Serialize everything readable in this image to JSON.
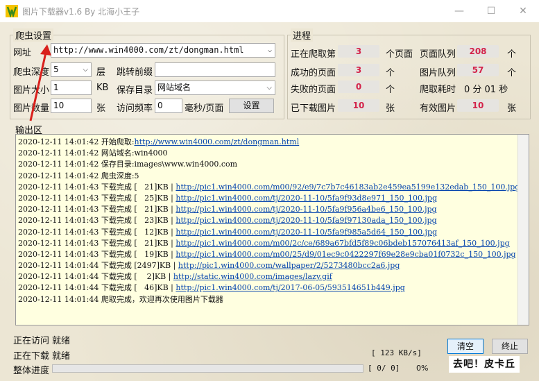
{
  "window": {
    "title": "图片下载器v1.6 By 北海小王子",
    "min_icon": "minimize-icon",
    "max_icon": "maximize-icon",
    "close_icon": "close-icon"
  },
  "settings": {
    "group_title": "爬虫设置",
    "url_label": "网址",
    "url_value": "http://www.win4000.com/zt/dongman.html",
    "depth_label": "爬虫深度",
    "depth_value": "5",
    "depth_unit": "层",
    "jump_prefix_label": "跳转前缀",
    "jump_prefix_value": "",
    "size_label": "图片大小",
    "size_value": "1",
    "size_unit": "KB",
    "save_dir_label": "保存目录",
    "save_dir_value": "网站域名",
    "count_label": "图片数量",
    "count_value": "10",
    "count_unit": "张",
    "freq_label": "访问频率",
    "freq_value": "0",
    "freq_unit": "毫秒/页面",
    "set_button": "设置"
  },
  "progress_group": {
    "title": "进程",
    "crawling_label": "正在爬取第",
    "crawling_value": "3",
    "crawling_unit": "个页面",
    "page_queue_label": "页面队列",
    "page_queue_value": "208",
    "page_queue_unit": "个",
    "success_label": "成功的页面",
    "success_value": "3",
    "success_unit": "个",
    "img_queue_label": "图片队列",
    "img_queue_value": "57",
    "img_queue_unit": "个",
    "fail_label": "失败的页面",
    "fail_value": "0",
    "fail_unit": "个",
    "time_label": "爬取耗时",
    "time_value": "0 分 01 秒",
    "downloaded_label": "已下载图片",
    "downloaded_value": "10",
    "downloaded_unit": "张",
    "valid_label": "有效图片",
    "valid_value": "10",
    "valid_unit": "张"
  },
  "output": {
    "title": "输出区",
    "lines": [
      {
        "text": "2020-12-11 14:01:42 开始爬取:",
        "link": "http://www.win4000.com/zt/dongman.html"
      },
      {
        "text": "2020-12-11 14:01:42 网站域名:win4000",
        "link": ""
      },
      {
        "text": "2020-12-11 14:01:42 保存目录:images\\www.win4000.com",
        "link": ""
      },
      {
        "text": "2020-12-11 14:01:42 爬虫深度:5",
        "link": ""
      },
      {
        "text": "2020-12-11 14:01:43 下载完成 [   21]KB | ",
        "link": "http://pic1.win4000.com/m00/92/e9/7c7b7c46183ab2e459ea5199e132edab_150_100.jpg"
      },
      {
        "text": "2020-12-11 14:01:43 下载完成 [   25]KB | ",
        "link": "http://pic1.win4000.com/tj/2020-11-10/5fa9f93d8e971_150_100.jpg"
      },
      {
        "text": "2020-12-11 14:01:43 下载完成 [   21]KB | ",
        "link": "http://pic1.win4000.com/tj/2020-11-10/5fa9f956a4be6_150_100.jpg"
      },
      {
        "text": "2020-12-11 14:01:43 下载完成 [   23]KB | ",
        "link": "http://pic1.win4000.com/tj/2020-11-10/5fa9f97130ada_150_100.jpg"
      },
      {
        "text": "2020-12-11 14:01:43 下载完成 [   12]KB | ",
        "link": "http://pic1.win4000.com/tj/2020-11-10/5fa9f985a5d64_150_100.jpg"
      },
      {
        "text": "2020-12-11 14:01:43 下载完成 [   21]KB | ",
        "link": "http://pic1.win4000.com/m00/2c/ce/689a67bfd5f89c06bdeb157076413af_150_100.jpg"
      },
      {
        "text": "2020-12-11 14:01:43 下载完成 [   19]KB | ",
        "link": "http://pic1.win4000.com/m00/25/d9/01ec9c0422297f69e28e9cba01f0732c_150_100.jpg"
      },
      {
        "text": "2020-12-11 14:01:44 下载完成 [2497]KB | ",
        "link": "http://pic1.win4000.com/wallpaper/2/5273480bcc2a6.jpg"
      },
      {
        "text": "2020-12-11 14:01:44 下载完成 [    2]KB | ",
        "link": "http://static.win4000.com/images/lazy.gif"
      },
      {
        "text": "2020-12-11 14:01:44 下载完成 [   46]KB | ",
        "link": "http://pic1.win4000.com/tj/2017-06-05/593514651b449.jpg"
      },
      {
        "text": "2020-12-11 14:01:44 爬取完成，欢迎再次使用图片下载器",
        "link": ""
      }
    ]
  },
  "status": {
    "visiting_label": "正在访问",
    "visiting_value": "就绪",
    "downloading_label": "正在下载",
    "downloading_value": "就绪",
    "speed": "[ 123 KB/s]",
    "overall_label": "整体进度",
    "overall_count": "[  0/  0]",
    "overall_percent": "0%",
    "overall_fraction": 0.0,
    "clear_button": "清空",
    "stop_button": "终止"
  },
  "watermark": "去吧！皮卡丘",
  "colors": {
    "stat_value": "#d3234a",
    "log_bg": "#ffffe0",
    "link": "#0645ad",
    "annotation_arrow": "#d9201c"
  }
}
